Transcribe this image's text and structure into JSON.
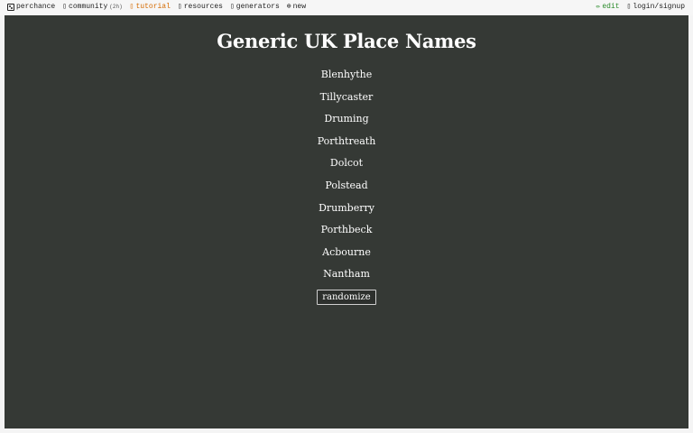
{
  "nav": {
    "brand": "perchance",
    "community": "community",
    "community_count": "(2h)",
    "tutorial": "tutorial",
    "resources": "resources",
    "generators": "generators",
    "new": "new",
    "edit": "edit",
    "login": "login/signup"
  },
  "icons": {
    "brand": "dice-icon",
    "community": "chat-icon",
    "tutorial": "book-icon",
    "resources": "resources-icon",
    "generators": "generators-icon",
    "new": "plus-circle-icon",
    "edit": "pencil-icon",
    "login": "user-icon"
  },
  "main": {
    "title": "Generic UK Place Names",
    "names": [
      "Blenhythe",
      "Tillycaster",
      "Druming",
      "Porthtreath",
      "Dolcot",
      "Polstead",
      "Drumberry",
      "Porthbeck",
      "Acbourne",
      "Nantham"
    ],
    "button_label": "randomize"
  },
  "colors": {
    "background": "#353935",
    "text": "#ffffff",
    "tutorial_accent": "#d46a00",
    "edit_accent": "#2a8a2a"
  }
}
